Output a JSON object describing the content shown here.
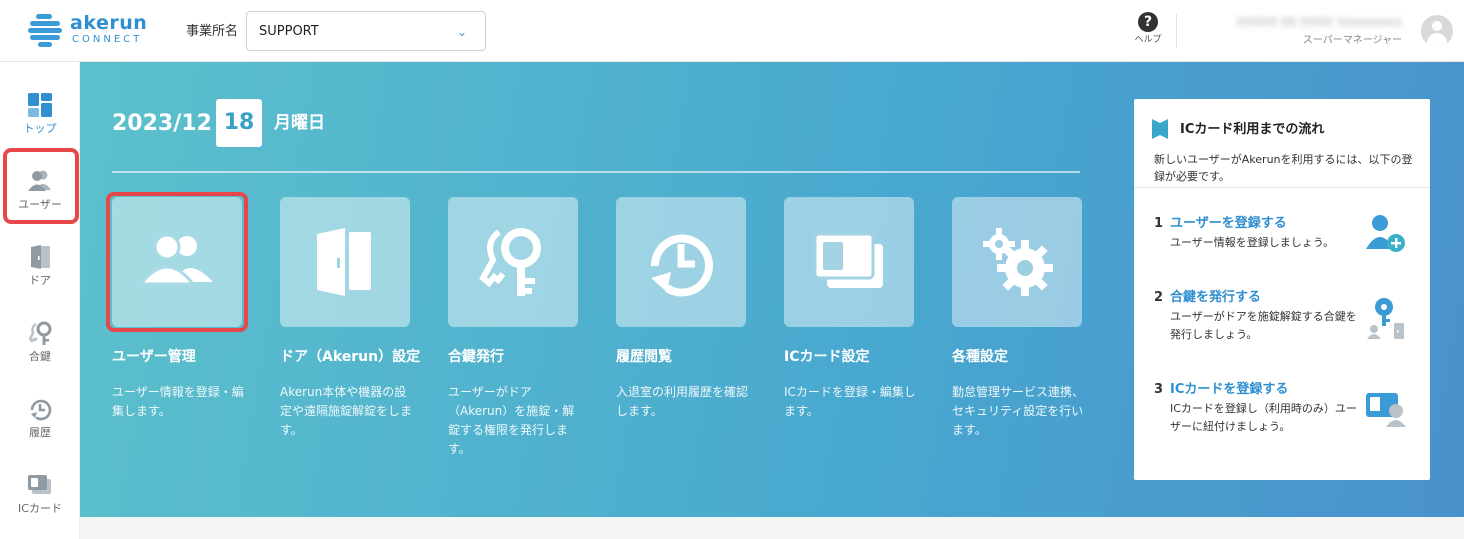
{
  "header": {
    "logo_text": "akerun",
    "logo_sub": "CONNECT",
    "office_label": "事業所名",
    "office_value": "SUPPORT",
    "help_label": "ヘルプ",
    "user_name": "XXXXX 00 XXXX Xxxxxxxxx",
    "user_role": "スーパーマネージャー"
  },
  "sidebar": {
    "items": [
      {
        "label": "トップ",
        "icon": "dashboard-icon"
      },
      {
        "label": "ユーザー",
        "icon": "users-icon"
      },
      {
        "label": "ドア",
        "icon": "door-icon"
      },
      {
        "label": "合鍵",
        "icon": "key-icon"
      },
      {
        "label": "履歴",
        "icon": "history-icon"
      },
      {
        "label": "ICカード",
        "icon": "ic-card-icon"
      }
    ]
  },
  "hero": {
    "year_month": "2023/12",
    "day": "18",
    "weekday": "月曜日"
  },
  "tiles": [
    {
      "title": "ユーザー管理",
      "desc": "ユーザー情報を登録・編集します。",
      "icon": "users-icon"
    },
    {
      "title": "ドア（Akerun）設定",
      "desc": "Akerun本体や機器の設定や遠隔施錠解錠をします。",
      "icon": "door-icon"
    },
    {
      "title": "合鍵発行",
      "desc": "ユーザーがドア（Akerun）を施錠・解錠する権限を発行します。",
      "icon": "key-icon"
    },
    {
      "title": "履歴閲覧",
      "desc": "入退室の利用履歴を確認します。",
      "icon": "history-icon"
    },
    {
      "title": "ICカード設定",
      "desc": "ICカードを登録・編集します。",
      "icon": "ic-card-icon"
    },
    {
      "title": "各種設定",
      "desc": "勤怠管理サービス連携、セキュリティ設定を行います。",
      "icon": "gear-icon"
    }
  ],
  "panel": {
    "title": "ICカード利用までの流れ",
    "intro": "新しいユーザーがAkerunを利用するには、以下の登録が必要です。",
    "steps": [
      {
        "num": "1",
        "link": "ユーザーを登録する",
        "text": "ユーザー情報を登録しましょう。",
        "icon": "add-user-icon"
      },
      {
        "num": "2",
        "link": "合鍵を発行する",
        "text": "ユーザーがドアを施錠解錠する合鍵を発行しましょう。",
        "icon": "key-door-icon"
      },
      {
        "num": "3",
        "link": "ICカードを登録する",
        "text": "ICカードを登録し（利用時のみ）ユーザーに紐付けましょう。",
        "icon": "card-user-icon"
      }
    ]
  },
  "colors": {
    "accent": "#2f8fd0",
    "highlight": "#e8474a",
    "hero_start": "#5cc0cc",
    "hero_end": "#4a91cc"
  }
}
